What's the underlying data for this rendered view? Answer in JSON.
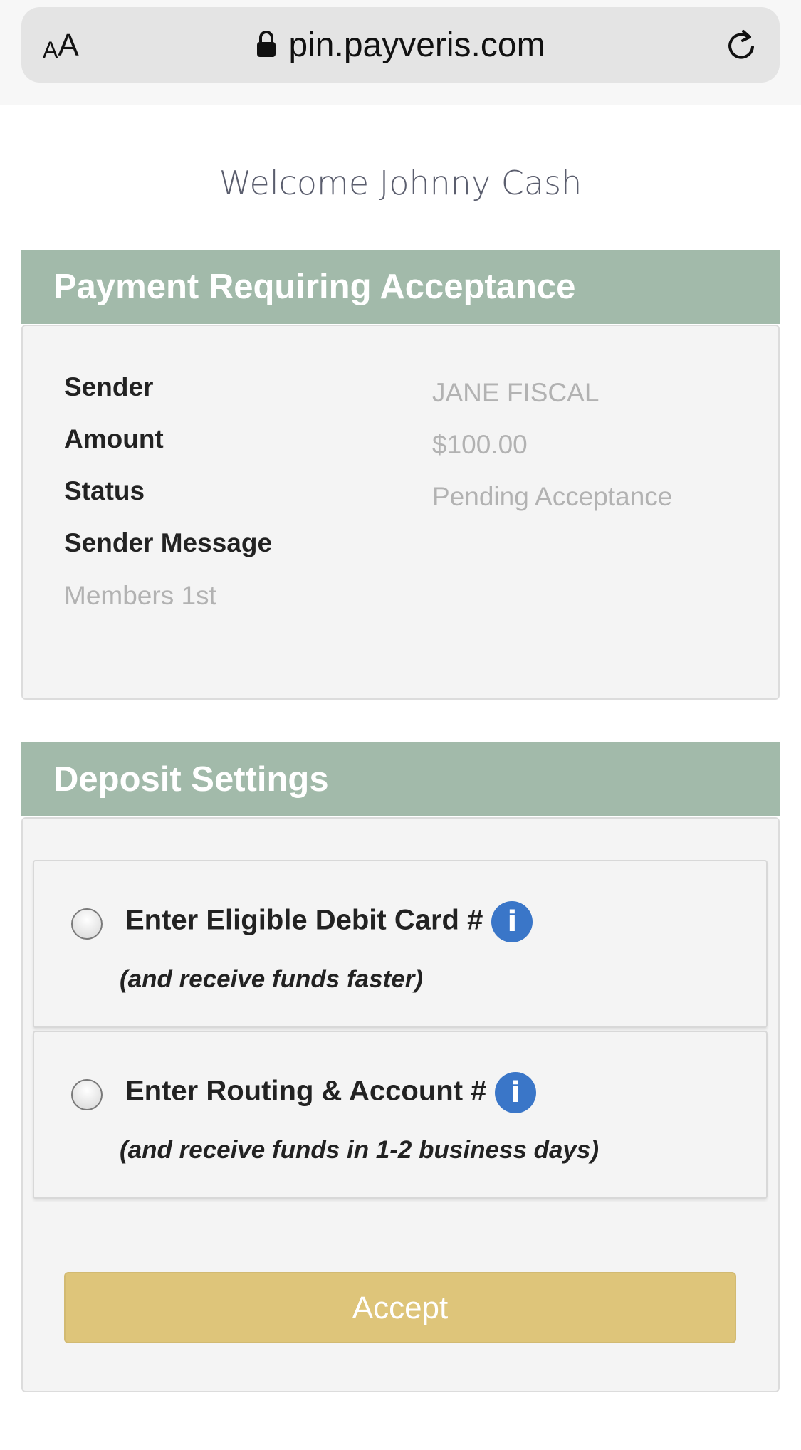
{
  "browser": {
    "text_size_small": "A",
    "text_size_large": "A",
    "url": "pin.payveris.com",
    "lock_icon": "lock-icon",
    "reload_icon": "reload-icon"
  },
  "welcome": "Welcome Johnny Cash",
  "payment_section": {
    "title": "Payment Requiring Acceptance",
    "sender_label": "Sender",
    "sender_value": "JANE FISCAL",
    "amount_label": "Amount",
    "amount_value": "$100.00",
    "status_label": "Status",
    "status_value": "Pending Acceptance",
    "message_label": "Sender Message",
    "message_value": "Members 1st"
  },
  "deposit_section": {
    "title": "Deposit Settings",
    "options": [
      {
        "title": "Enter Eligible Debit Card #",
        "subtitle": "(and receive funds faster)",
        "info": "i"
      },
      {
        "title": "Enter Routing & Account #",
        "subtitle": "(and receive funds in 1-2 business days)",
        "info": "i"
      }
    ],
    "accept_label": "Accept"
  },
  "colors": {
    "header_bg": "#a2baaa",
    "panel_bg": "#f4f4f4",
    "info_blue": "#3a76c8",
    "accept_bg": "#dec57a"
  }
}
